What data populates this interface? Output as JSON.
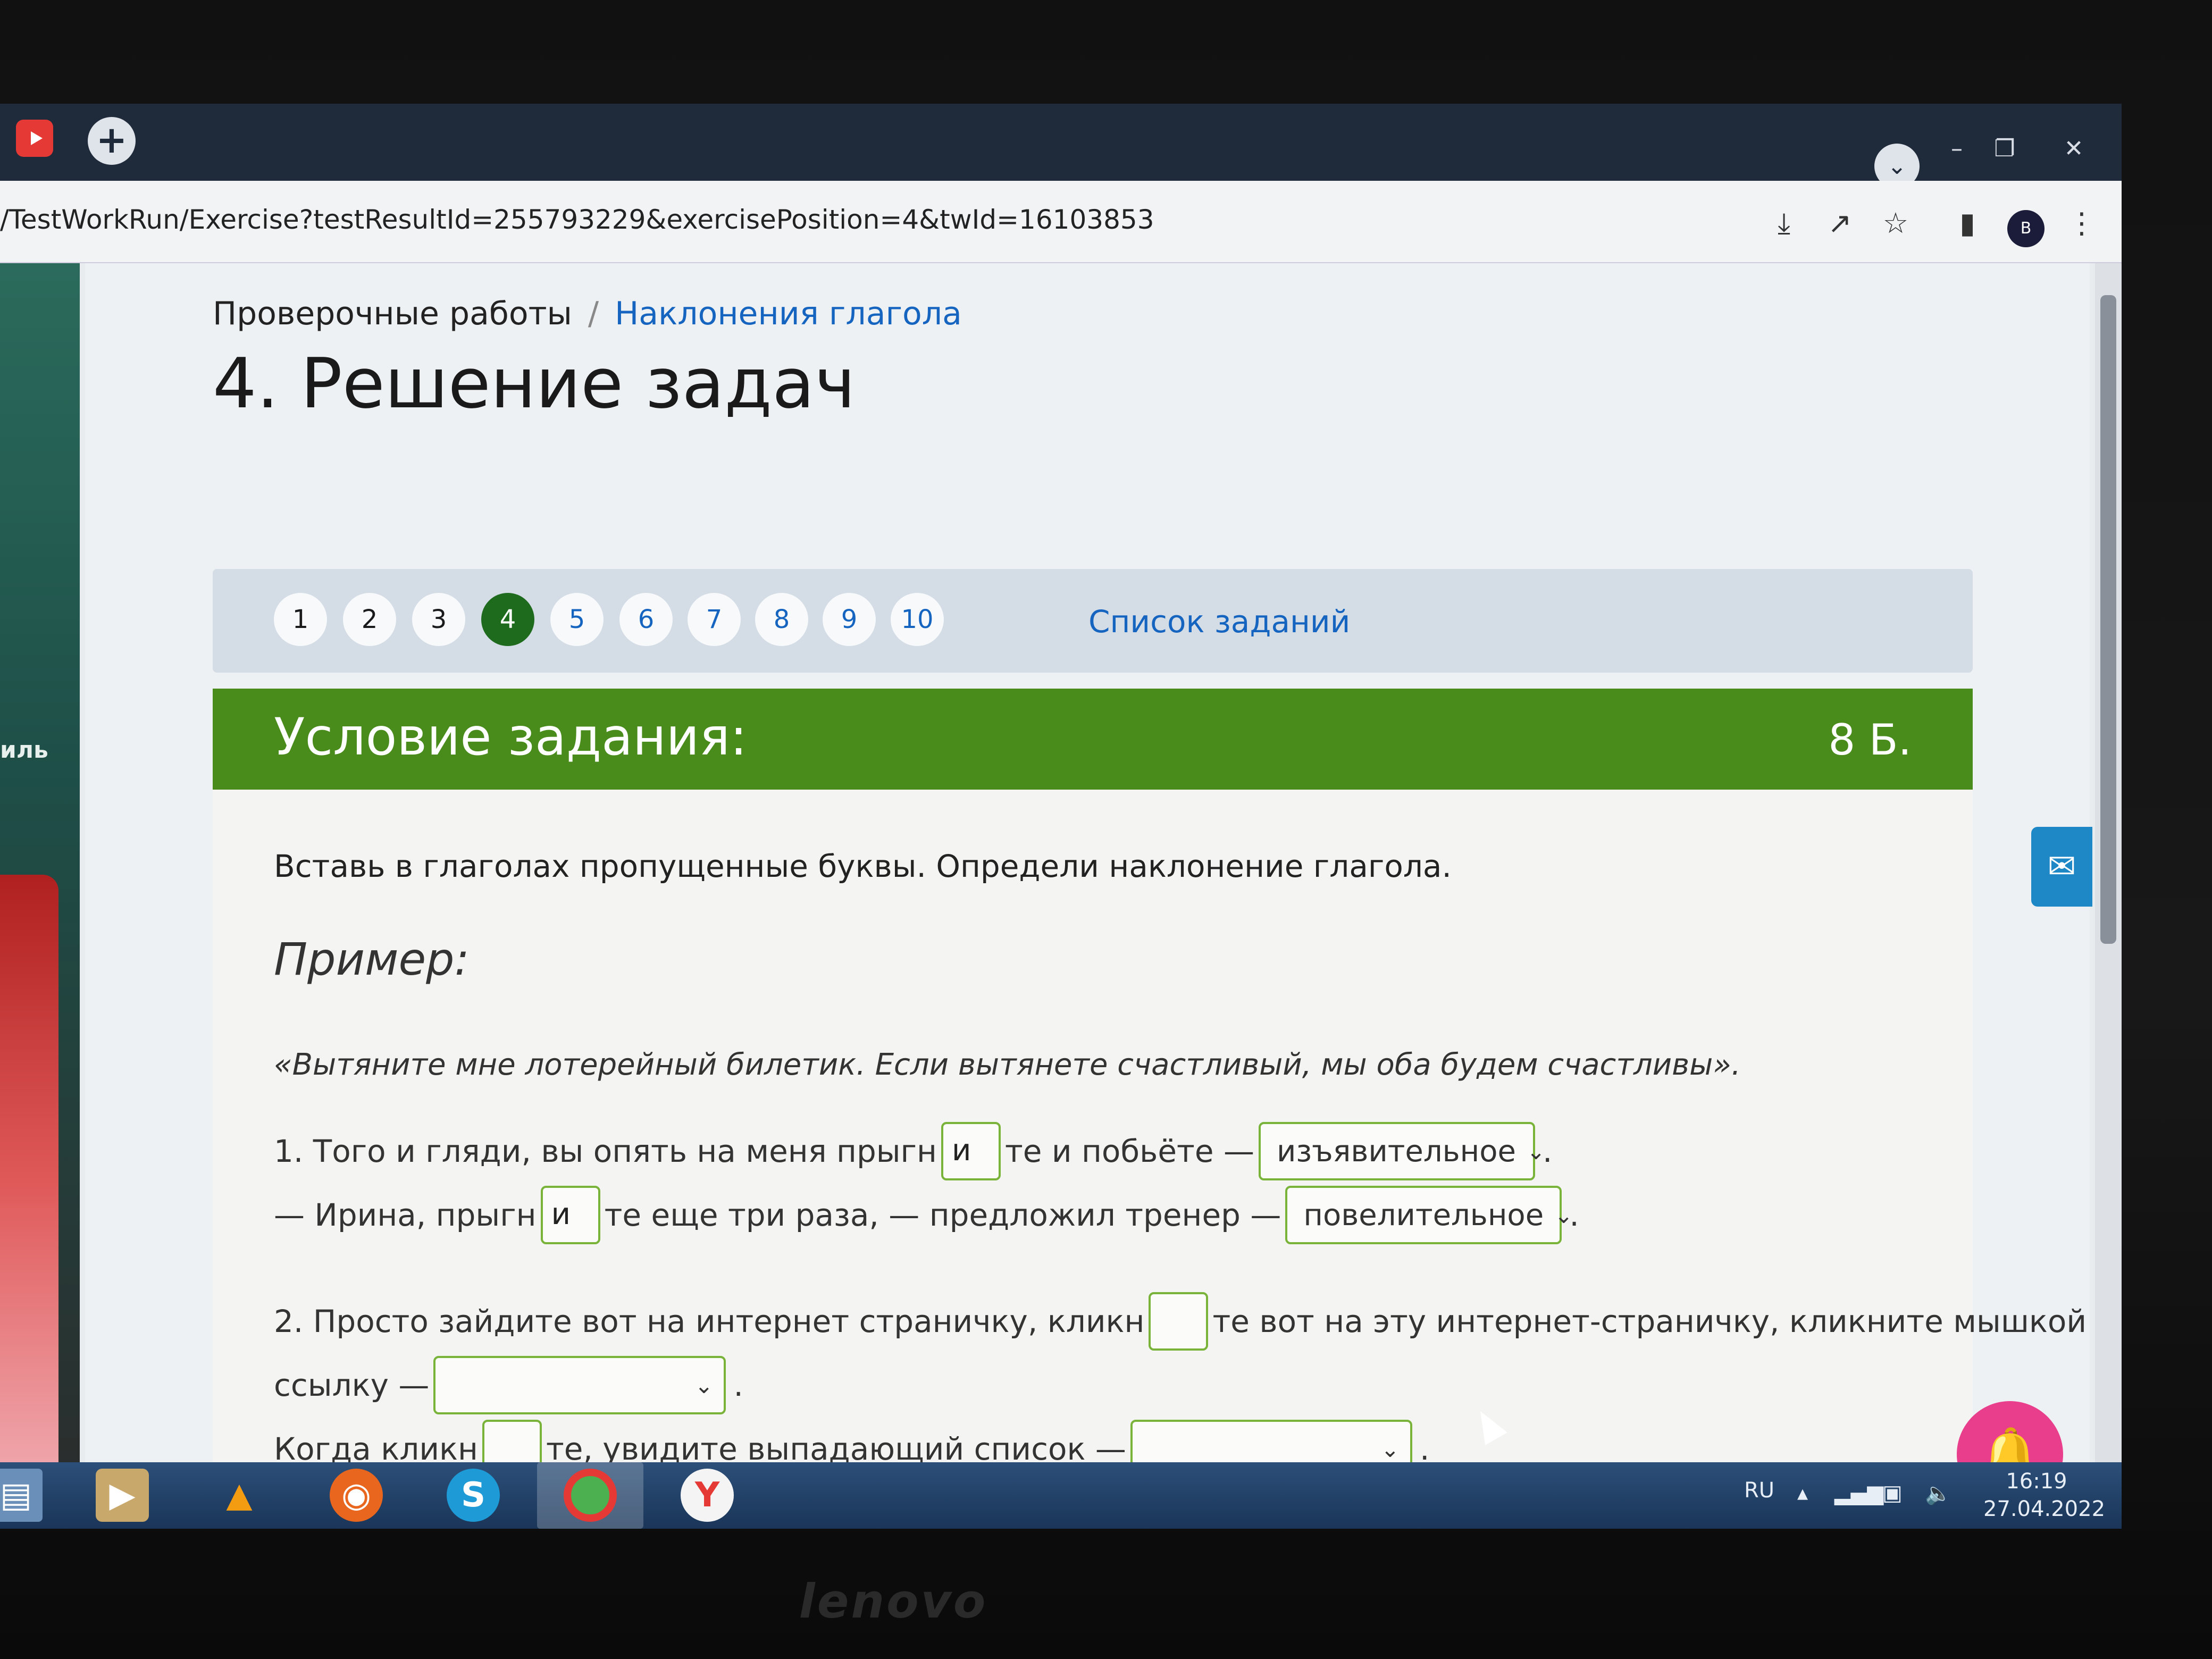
{
  "browser": {
    "url": "/TestWorkRun/Exercise?testResultId=255793229&exercisePosition=4&twId=16103853",
    "profile_initial": "B"
  },
  "sidebar": {
    "label": "иль"
  },
  "breadcrumb": {
    "root": "Проверочные работы",
    "separator": "/",
    "current": "Наклонения глагола"
  },
  "page_title": "4. Решение задач",
  "pager": {
    "pages": [
      {
        "label": "1",
        "state": "done"
      },
      {
        "label": "2",
        "state": "done"
      },
      {
        "label": "3",
        "state": "done"
      },
      {
        "label": "4",
        "state": "active"
      },
      {
        "label": "5",
        "state": "todo"
      },
      {
        "label": "6",
        "state": "todo"
      },
      {
        "label": "7",
        "state": "todo"
      },
      {
        "label": "8",
        "state": "todo"
      },
      {
        "label": "9",
        "state": "todo"
      },
      {
        "label": "10",
        "state": "todo"
      }
    ],
    "list_link": "Список заданий"
  },
  "task": {
    "header_title": "Условие задания:",
    "score": "8 Б.",
    "instruction": "Вставь в глаголах пропущенные буквы. Определи наклонение глагола.",
    "example_title": "Пример:",
    "example_text": "«Вытяните мне лотерейный билетик. Если вытянете счастливый, мы оба будем счастливы».",
    "q1": {
      "line1_a": "1. Того и гляди, вы опять на меня прыгн",
      "line1_gap": "и",
      "line1_b": "те и побьёте —",
      "line1_select": "изъявительное",
      "line2_a": "— Ирина, прыгн",
      "line2_gap": "и",
      "line2_b": "те еще три раза, — предложил тренер —",
      "line2_select": "повелительное"
    },
    "q2": {
      "line1_a": "2. Просто зайдите вот на интернет страничку, кликн",
      "line1_gap": "",
      "line1_b": "те вот на эту интернет-страничку, кликните мышкой на",
      "line2_a": "ссылку —",
      "line2_select": "",
      "line3_a": "Когда кликн",
      "line3_gap": "",
      "line3_b": "те, увидите выпадающий список —",
      "line3_select": ""
    },
    "period": "."
  },
  "taskbar": {
    "lang": "RU",
    "time": "16:19",
    "date": "27.04.2022"
  },
  "colors": {
    "task_header": "#4a8c1c",
    "active_page": "#1e6b1e",
    "link": "#1565c0",
    "field_border": "#7ab33a",
    "bell": "#e83e8c",
    "mail": "#1e88c7"
  }
}
